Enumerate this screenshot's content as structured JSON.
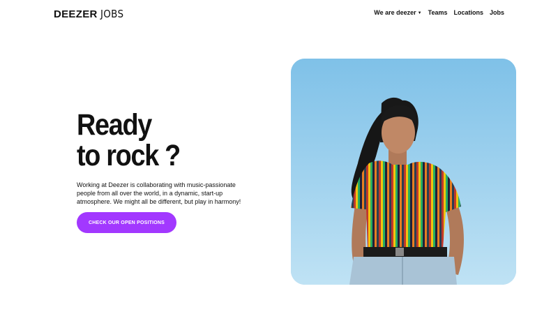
{
  "header": {
    "logo": {
      "brand": "DEEZER",
      "suffix": "JOBS"
    },
    "nav": [
      {
        "label": "We are deezer",
        "has_dropdown": true,
        "icon": "chevron-down-icon"
      },
      {
        "label": "Teams"
      },
      {
        "label": "Locations"
      },
      {
        "label": "Jobs"
      }
    ]
  },
  "hero": {
    "title_line1": "Ready",
    "title_line2": "to rock ?",
    "description": "Working at Deezer is collaborating with music-passionate people from all over the world, in a dynamic, start-up atmosphere. We might all be different, but play in harmony!",
    "cta_label": "CHECK OUR OPEN POSITIONS"
  },
  "colors": {
    "accent": "#a238ff",
    "text": "#111111",
    "background": "#ffffff",
    "sky": "#8ec9ea"
  }
}
